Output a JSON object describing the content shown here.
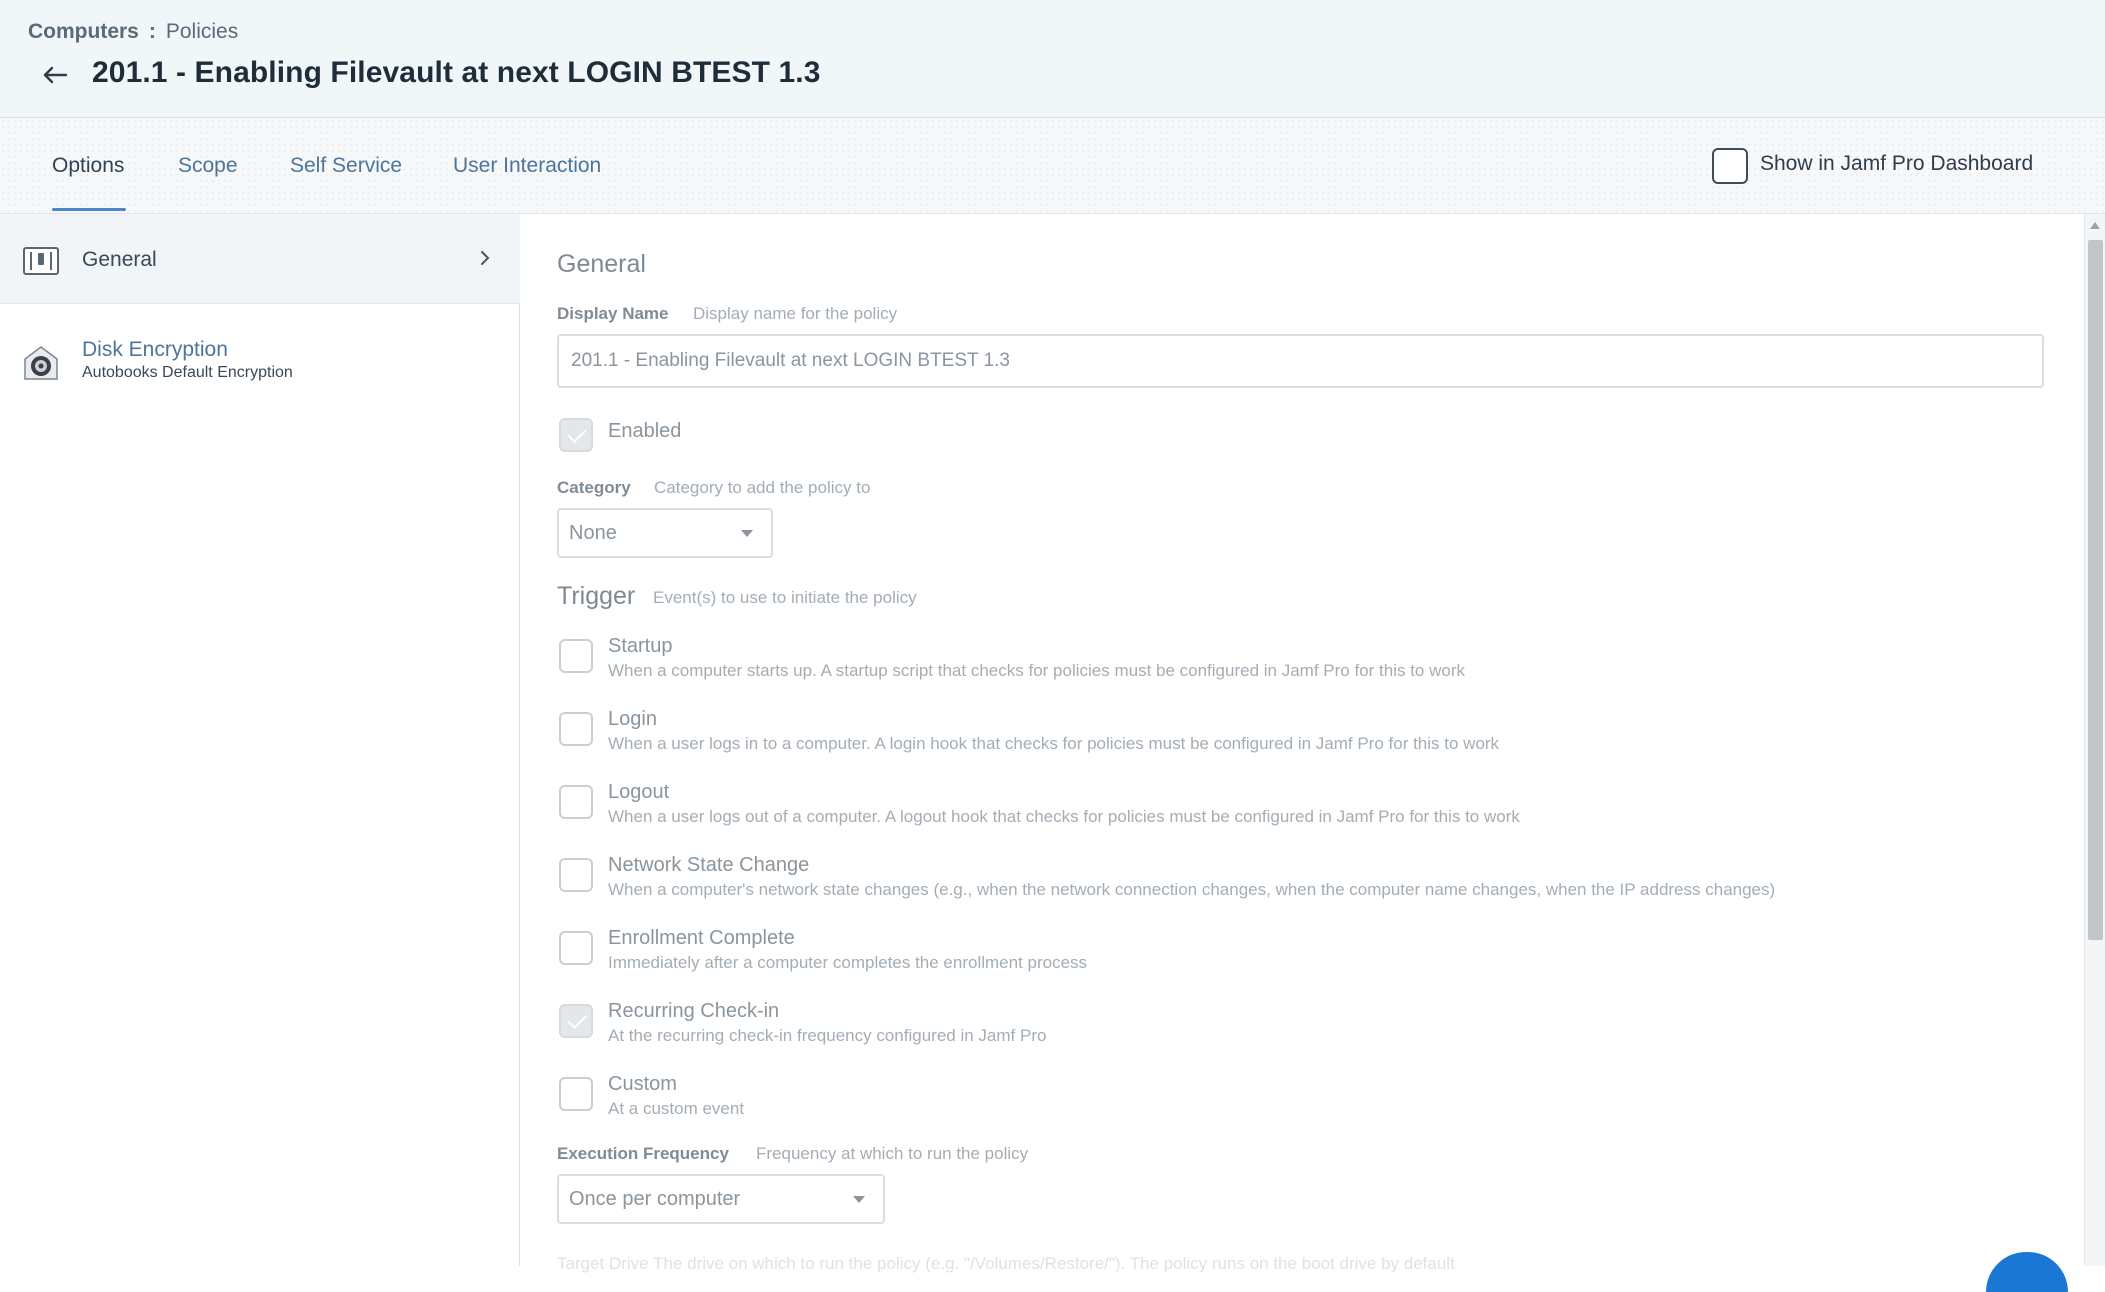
{
  "breadcrumb": {
    "root": "Computers",
    "separator": ":",
    "current": "Policies"
  },
  "page_title": "201.1 - Enabling Filevault at next LOGIN BTEST 1.3",
  "tabs": [
    {
      "label": "Options",
      "active": true
    },
    {
      "label": "Scope",
      "active": false
    },
    {
      "label": "Self Service",
      "active": false
    },
    {
      "label": "User Interaction",
      "active": false
    }
  ],
  "dashboard": {
    "label": "Show in Jamf Pro Dashboard",
    "checked": false
  },
  "sidebar": {
    "items": [
      {
        "label": "General",
        "icon": "general-settings-icon",
        "selected": true
      },
      {
        "label": "Disk Encryption",
        "sublabel": "Autobooks Default Encryption",
        "icon": "filevault-icon",
        "selected": false
      }
    ]
  },
  "general": {
    "section_title": "General",
    "display_name": {
      "label": "Display Name",
      "hint": "Display name for the policy",
      "value": "201.1 - Enabling Filevault at next LOGIN BTEST 1.3"
    },
    "enabled": {
      "label": "Enabled",
      "checked": true
    },
    "category": {
      "label": "Category",
      "hint": "Category to add the policy to",
      "value": "None"
    },
    "trigger": {
      "title": "Trigger",
      "hint": "Event(s) to use to initiate the policy",
      "items": [
        {
          "label": "Startup",
          "desc": "When a computer starts up. A startup script that checks for policies must be configured in Jamf Pro for this to work",
          "checked": false
        },
        {
          "label": "Login",
          "desc": "When a user logs in to a computer. A login hook that checks for policies must be configured in Jamf Pro for this to work",
          "checked": false
        },
        {
          "label": "Logout",
          "desc": "When a user logs out of a computer. A logout hook that checks for policies must be configured in Jamf Pro for this to work",
          "checked": false
        },
        {
          "label": "Network State Change",
          "desc": "When a computer's network state changes (e.g., when the network connection changes, when the computer name changes, when the IP address changes)",
          "checked": false
        },
        {
          "label": "Enrollment Complete",
          "desc": "Immediately after a computer completes the enrollment process",
          "checked": false
        },
        {
          "label": "Recurring Check-in",
          "desc": "At the recurring check-in frequency configured in Jamf Pro",
          "checked": true
        },
        {
          "label": "Custom",
          "desc": "At a custom event",
          "checked": false
        }
      ]
    },
    "execution_frequency": {
      "label": "Execution Frequency",
      "hint": "Frequency at which to run the policy",
      "value": "Once per computer"
    },
    "target_drive_faded": "Target Drive    The drive on which to run the policy (e.g. \"/Volumes/Restore/\"). The policy runs on the boot drive by default"
  },
  "colors": {
    "accent": "#4f86c6",
    "link": "#4d7599",
    "header_bg": "#f1f6f8",
    "fab": "#1a78d4"
  }
}
